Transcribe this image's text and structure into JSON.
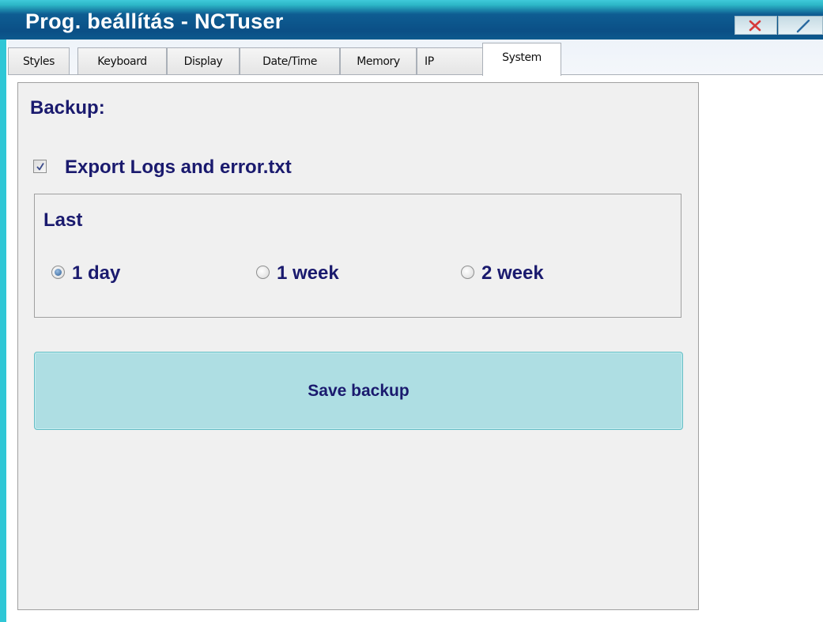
{
  "window": {
    "title": "Prog. beállítás - NCTuser"
  },
  "tabs": [
    {
      "label": "Styles"
    },
    {
      "label": "Keyboard"
    },
    {
      "label": "Display"
    },
    {
      "label": "Date/Time"
    },
    {
      "label": "Memory"
    },
    {
      "label": "IP"
    },
    {
      "label": "System",
      "active": true
    }
  ],
  "system": {
    "heading": "Backup:",
    "export_checkbox": {
      "label": "Export Logs and error.txt",
      "checked": true
    },
    "last_group": {
      "label": "Last",
      "options": [
        {
          "label": "1 day",
          "selected": true
        },
        {
          "label": "1 week",
          "selected": false
        },
        {
          "label": "2 week",
          "selected": false
        }
      ]
    },
    "save_button_label": "Save backup"
  },
  "colors": {
    "accent_text": "#1a1a6e",
    "titlebar": "#0b4f86",
    "button_fill": "#aedee3"
  }
}
